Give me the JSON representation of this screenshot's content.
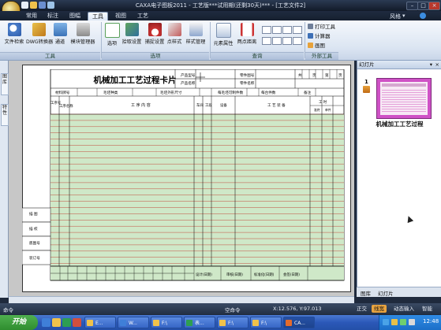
{
  "window": {
    "title": "CAXA电子图板2011 - 工艺版***试用期(还剩30天)*** - [工艺文件2]",
    "style_label": "风格",
    "style_arrow": "▾",
    "btn_min": "–",
    "btn_max": "□",
    "btn_close": "×"
  },
  "menu_tabs": [
    "常用",
    "标注",
    "图幅",
    "工具",
    "视图",
    "工艺"
  ],
  "active_tab": "工具",
  "ribbon": {
    "tool_group_label": "工具",
    "options_group_label": "选项",
    "query_group_label": "查询",
    "external_group_label": "外部工具",
    "buttons": {
      "file_search": "文件检索",
      "dwg_converter": "DWG转换器",
      "channel": "通道",
      "module_manager": "模块管理器",
      "options": "选项",
      "snap_settings": "拾取设置",
      "catch_settings": "捕捉设置",
      "dot_style": "点样式",
      "style_manager": "样式管理",
      "element_attr": "元素属性",
      "two_point_distance": "两点距离",
      "print_tool": "打印工具",
      "calculator": "计算器",
      "paint": "画图"
    }
  },
  "left_panel": {
    "tab_layers": "图库",
    "tab_properties": "特性"
  },
  "process_card": {
    "title": "机械加工工艺过程卡片",
    "header_cells": [
      "产品型号",
      "零件图号",
      "产品名称",
      "零件名称",
      "共",
      "页",
      "第",
      "页"
    ],
    "row2_cells": [
      "材料牌号",
      "毛坯种类",
      "毛坯外形尺寸",
      "每毛坯可制件数",
      "每台件数",
      "备注"
    ],
    "col_headers": [
      "工序号",
      "工序名称",
      "工 序 内 容",
      "车间",
      "工段",
      "设备",
      "工 艺 装 备",
      "工 时"
    ],
    "time_subheaders": [
      "准终",
      "单件"
    ],
    "side_labels": [
      "描 图",
      "描 校",
      "底图号",
      "装订号"
    ],
    "footer_labels": [
      "设计(日期)",
      "审核(日期)",
      "标准化(日期)",
      "会签(日期)"
    ]
  },
  "right_panel": {
    "header": "幻灯片",
    "slide_number": "1",
    "slide_label": "机械加工工艺过程",
    "bottom_tabs": [
      "图库",
      "幻灯片"
    ]
  },
  "status": {
    "command_label": "命令",
    "center_prompt": "空命令",
    "coords": "X:12.576, Y:97.013",
    "mode_ortho": "正交",
    "mode_line": "线宽",
    "mode_dynamic": "动态输入",
    "mode_smart": "智能"
  },
  "taskbar": {
    "start_label": "开始",
    "tasks": [
      "E...",
      "W...",
      "F:\\",
      "表...",
      "F:\\",
      "F:\\",
      "CA..."
    ],
    "clock": "12:48"
  },
  "colors": {
    "title_bar": "#1c2638",
    "ribbon": "#dbe5f2",
    "canvas_bg": "#c7c7c7",
    "row_green": "#cfe8c8",
    "grid_red": "#c0392b",
    "thumb_accent": "#cf52c6",
    "taskbar": "#2b58b8",
    "status_highlight": "#e9a440"
  }
}
